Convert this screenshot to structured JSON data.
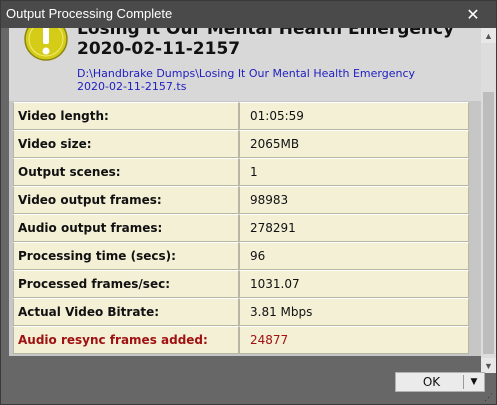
{
  "window": {
    "title": "Output Processing Complete",
    "close_glyph": "✕"
  },
  "header": {
    "icon": "exclamation-warning-icon",
    "title_line1": "Losing It Our Mental Health Emergency",
    "title_line2": "2020-02-11-2157",
    "path_line1": "D:\\Handbrake Dumps\\Losing It Our Mental Health Emergency",
    "path_line2": "2020-02-11-2157.ts"
  },
  "stats": [
    {
      "label": "Video length:",
      "value": "01:05:59"
    },
    {
      "label": "Video size:",
      "value": "2065MB"
    },
    {
      "label": "Output scenes:",
      "value": "1"
    },
    {
      "label": "Video output frames:",
      "value": "98983"
    },
    {
      "label": "Audio output frames:",
      "value": "278291"
    },
    {
      "label": "Processing time (secs):",
      "value": "96"
    },
    {
      "label": "Processed frames/sec:",
      "value": "1031.07"
    },
    {
      "label": "Actual Video Bitrate:",
      "value": "3.81 Mbps"
    },
    {
      "label": "Audio resync frames added:",
      "value": "24877"
    }
  ],
  "colors": {
    "alert_text": "#a01212",
    "path_link": "#2020c0",
    "warning_icon": "#d4cc16"
  },
  "footer": {
    "ok_label": "OK",
    "dropdown_glyph": "▼"
  }
}
